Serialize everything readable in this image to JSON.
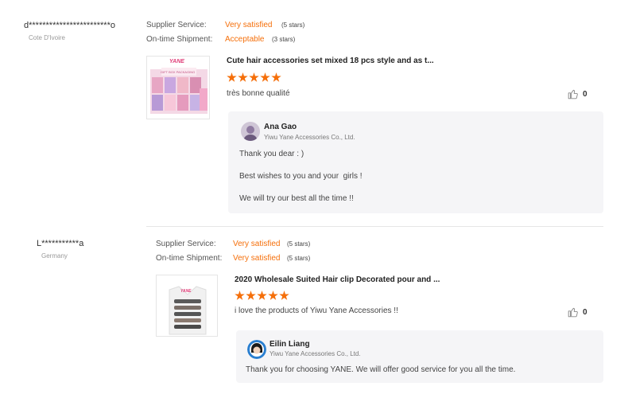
{
  "reviews": [
    {
      "buyer_name": "d************************o",
      "buyer_country": "Cote D'Ivoire",
      "ratings": [
        {
          "label": "Supplier Service:",
          "value": "Very satisfied",
          "stars": "(5 stars)"
        },
        {
          "label": "On-time Shipment:",
          "value": "Acceptable",
          "stars": "(3 stars)"
        }
      ],
      "product": {
        "title": "Cute hair accessories set mixed 18 pcs style and as t...",
        "rating": 5,
        "thumb_brand": "YANE",
        "thumb_caption": "GIFT BOX PACKAGING"
      },
      "comment": "très bonne qualité",
      "likes": "0",
      "reply": {
        "name": "Ana Gao",
        "company": "Yiwu Yane Accessories Co., Ltd.",
        "lines": [
          "Thank you dear : )",
          "Best wishes to you and your  girls !",
          "We will try our best all the time !!"
        ]
      }
    },
    {
      "buyer_name": "L***********a",
      "buyer_country": "Germany",
      "ratings": [
        {
          "label": "Supplier Service:",
          "value": "Very satisfied",
          "stars": "(5 stars)"
        },
        {
          "label": "On-time Shipment:",
          "value": "Very satisfied",
          "stars": "(5 stars)"
        }
      ],
      "product": {
        "title": "2020 Wholesale Suited Hair clip Decorated pour and ...",
        "rating": 5,
        "thumb_brand": "YANE"
      },
      "comment": "i love the products of Yiwu Yane Accessories !!",
      "likes": "0",
      "reply": {
        "name": "Eilin Liang",
        "company": "Yiwu Yane Accessories Co., Ltd.",
        "lines": [
          "Thank you for choosing YANE. We will offer good service for you all the time."
        ]
      }
    }
  ],
  "colors": {
    "accent": "#f56f0a",
    "reply_bg": "#f5f5f7",
    "muted": "#999999"
  },
  "icons": [
    "thumbs-up-icon",
    "star-icon",
    "avatar"
  ]
}
